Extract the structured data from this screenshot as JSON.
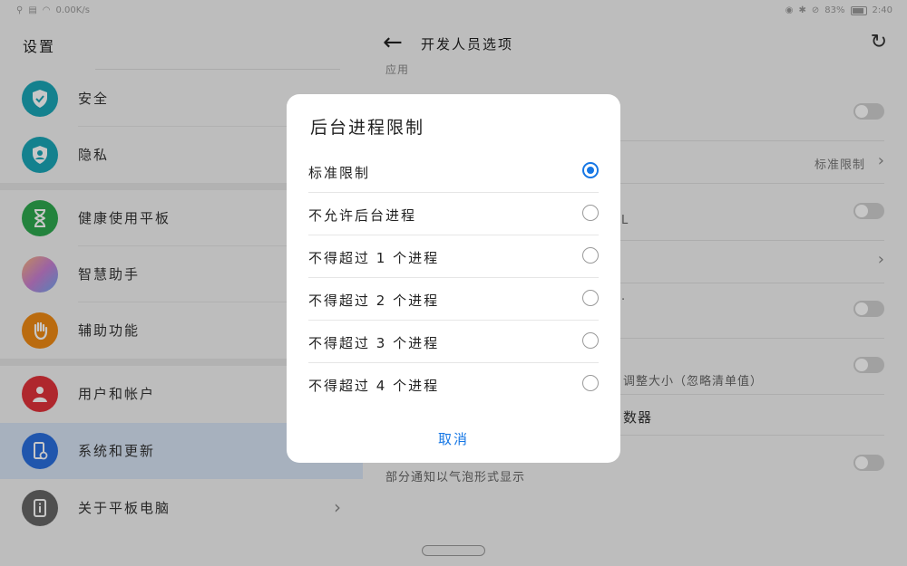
{
  "status": {
    "speed": "0.00K/s",
    "battery": "83%",
    "time": "2:40",
    "battery_fill": 0.83
  },
  "left": {
    "title": "设置",
    "items": [
      {
        "label": "安全",
        "icon": "shield-check-icon",
        "color": "#1aa6b7"
      },
      {
        "label": "隐私",
        "icon": "shield-user-icon",
        "color": "#1aa6b7"
      },
      {
        "label": "健康使用平板",
        "icon": "hourglass-icon",
        "color": "#2ea84f"
      },
      {
        "label": "智慧助手",
        "icon": "assistant-orb-icon",
        "color": "#c87fd1"
      },
      {
        "label": "辅助功能",
        "icon": "hand-icon",
        "color": "#ef8a14"
      },
      {
        "label": "用户和帐户",
        "icon": "user-icon",
        "color": "#e0323a"
      },
      {
        "label": "系统和更新",
        "icon": "system-update-icon",
        "color": "#2a6fde"
      },
      {
        "label": "关于平板电脑",
        "icon": "info-icon",
        "color": "#666666"
      }
    ],
    "chevron": "›"
  },
  "right": {
    "title": "开发人员选项",
    "section": "应用",
    "row_value": "标准限制",
    "frag_text_1": "调整大小（忽略清单值）",
    "frag_text_2": "数器",
    "frag_text_3": "部分通知以气泡形式显示",
    "frag_text_4": "L",
    "frag_text_5": "·"
  },
  "dialog": {
    "title": "后台进程限制",
    "options": [
      {
        "label": "标准限制",
        "checked": true
      },
      {
        "label": "不允许后台进程",
        "checked": false
      },
      {
        "label": "不得超过 1 个进程",
        "checked": false
      },
      {
        "label": "不得超过 2 个进程",
        "checked": false
      },
      {
        "label": "不得超过 3 个进程",
        "checked": false
      },
      {
        "label": "不得超过 4 个进程",
        "checked": false
      }
    ],
    "cancel": "取消"
  },
  "colors": {
    "accent": "#1677e5",
    "selected_bg": "#d6e3f4"
  }
}
